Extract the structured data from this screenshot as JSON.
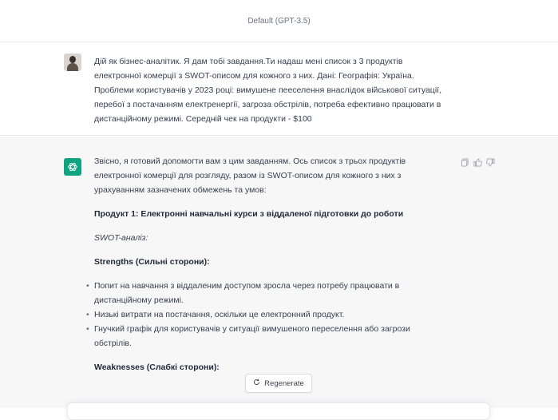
{
  "model_bar": {
    "label": "Default (GPT-3.5)"
  },
  "user_message": {
    "lines": [
      "Дій як бізнес-аналітик. Я дам  тобі завдання.Ти надаш мені список з 3 продуктів",
      "електронної комерції з SWOT-описом для кожного з них. Дані: Географія: Україна.",
      "Проблеми користувачів у 2023 році: вимушене пееселення внаслідок військової ситуації,",
      "перебої  з постачанням електренергії, загроза обстрілів, потреба ефективно працювати в",
      "дистанційному режимі. Середній чек на продукти - $100"
    ]
  },
  "assistant_message": {
    "intro_lines": [
      "Звісно, я готовий допомогти вам з цим завданням. Ось список з трьох продуктів",
      "електронної комерції для розгляду, разом із SWOT-описом для кожного з них з",
      "урахуванням зазначених обмежень та умов:"
    ],
    "product_title": "Продукт 1: Електронні навчальні курси з віддаленої підготовки до роботи",
    "swot_label": "SWOT-аналіз:",
    "strengths_heading": "Strengths (Сильні сторони):",
    "strengths": [
      [
        "Попит на навчання з віддаленим доступом зросла через потребу працювати в",
        "дистанційному режимі."
      ],
      [
        "Низькі витрати на постачання, оскільки це електронний продукт."
      ],
      [
        "Гнучкий графік для користувачів у ситуації вимушеного переселення або загрози",
        "обстрілів."
      ]
    ],
    "weaknesses_heading": "Weaknesses (Слабкі сторони):"
  },
  "actions": {
    "icons": [
      "copy-icon",
      "thumbs-up-icon",
      "thumbs-down-icon"
    ]
  },
  "regenerate": {
    "label": "Regenerate",
    "icon": "refresh-icon"
  },
  "colors": {
    "accent": "#10a37f",
    "assistant_bg": "#f7f7f8",
    "text": "#374151"
  }
}
